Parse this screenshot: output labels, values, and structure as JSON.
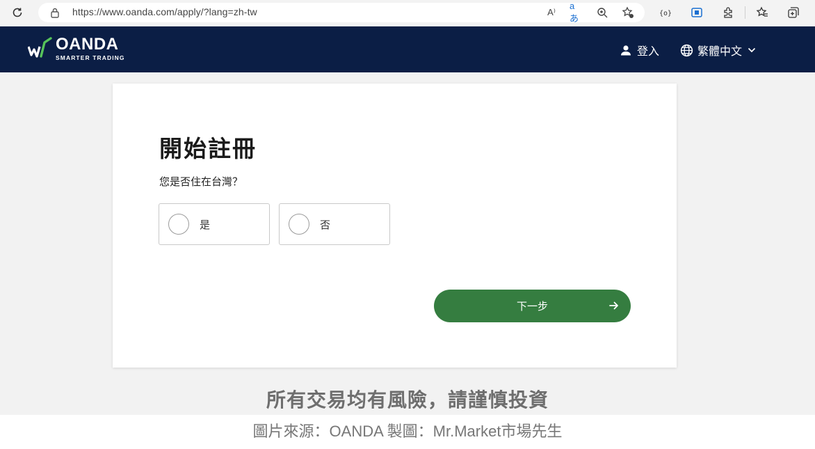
{
  "browser": {
    "url": "https://www.oanda.com/apply/?lang=zh-tw",
    "read_aloud": "A⁾",
    "translate": "aあ"
  },
  "header": {
    "logo_name": "OANDA",
    "logo_tagline": "SMARTER TRADING",
    "login_label": "登入",
    "language_label": "繁體中文"
  },
  "form": {
    "title": "開始註冊",
    "question": "您是否住在台灣？",
    "options": [
      {
        "label": "是"
      },
      {
        "label": "否"
      }
    ],
    "next_label": "下一步"
  },
  "caption": {
    "warning": "所有交易均有風險，請謹慎投資",
    "source": "圖片來源：OANDA 製圖：Mr.Market市場先生"
  },
  "colors": {
    "header_bg": "#0b1e45",
    "logo_accent": "#56c35a",
    "button_green": "#357d40"
  }
}
